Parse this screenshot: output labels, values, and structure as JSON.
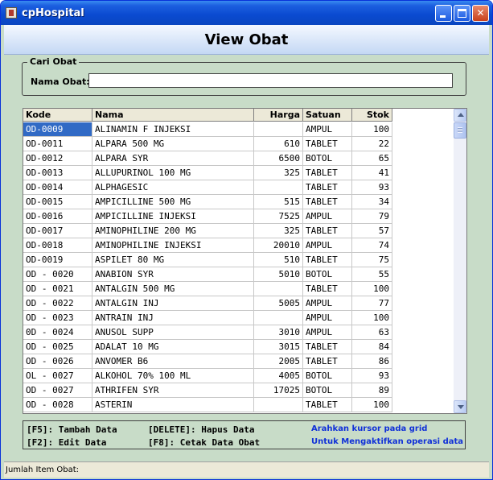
{
  "window": {
    "title": "cpHospital"
  },
  "header": {
    "title": "View Obat"
  },
  "search": {
    "group_label": "Cari Obat",
    "field_label": "Nama Obat:",
    "value": ""
  },
  "grid": {
    "columns": [
      "Kode",
      "Nama",
      "Harga",
      "Satuan",
      "Stok"
    ],
    "selected_row": 0,
    "rows": [
      [
        "OD-0009",
        "ALINAMIN F INJEKSI",
        "",
        "AMPUL",
        "100"
      ],
      [
        "OD-0011",
        "ALPARA 500 MG",
        "610",
        "TABLET",
        "22"
      ],
      [
        "OD-0012",
        "ALPARA SYR",
        "6500",
        "BOTOL",
        "65"
      ],
      [
        "OD-0013",
        "ALLUPURINOL 100 MG",
        "325",
        "TABLET",
        "41"
      ],
      [
        "OD-0014",
        "ALPHAGESIC",
        "",
        "TABLET",
        "93"
      ],
      [
        "OD-0015",
        "AMPICILLINE 500 MG",
        "515",
        "TABLET",
        "34"
      ],
      [
        "OD-0016",
        "AMPICILLINE INJEKSI",
        "7525",
        "AMPUL",
        "79"
      ],
      [
        "OD-0017",
        "AMINOPHILINE 200 MG",
        "325",
        "TABLET",
        "57"
      ],
      [
        "OD-0018",
        "AMINOPHILINE INJEKSI",
        "20010",
        "AMPUL",
        "74"
      ],
      [
        "OD-0019",
        "ASPILET 80 MG",
        "510",
        "TABLET",
        "75"
      ],
      [
        "OD - 0020",
        "ANABION SYR",
        "5010",
        "BOTOL",
        "55"
      ],
      [
        "OD - 0021",
        "ANTALGIN 500 MG",
        "",
        "TABLET",
        "100"
      ],
      [
        "OD - 0022",
        "ANTALGIN INJ",
        "5005",
        "AMPUL",
        "77"
      ],
      [
        "OD - 0023",
        "ANTRAIN INJ",
        "",
        "AMPUL",
        "100"
      ],
      [
        "0D - 0024",
        "ANUSOL SUPP",
        "3010",
        "AMPUL",
        "63"
      ],
      [
        "OD - 0025",
        "ADALAT 10 MG",
        "3015",
        "TABLET",
        "84"
      ],
      [
        "OD - 0026",
        "ANVOMER B6",
        "2005",
        "TABLET",
        "86"
      ],
      [
        "OL - 0027",
        "ALKOHOL 70% 100 ML",
        "4005",
        "BOTOL",
        "93"
      ],
      [
        "OD - 0027",
        "ATHRIFEN SYR",
        "17025",
        "BOTOL",
        "89"
      ],
      [
        "OD - 0028",
        "ASTERIN",
        "",
        "TABLET",
        "100"
      ]
    ]
  },
  "shortcuts": {
    "f5": "[F5]: Tambah Data",
    "f2": "[F2]: Edit Data",
    "delete": "[DELETE]: Hapus Data",
    "f8": "[F8]: Cetak Data Obat",
    "hint1": "Arahkan kursor pada grid",
    "hint2": "Untuk Mengaktifkan operasi data"
  },
  "status": {
    "text": "Jumlah Item Obat:"
  }
}
